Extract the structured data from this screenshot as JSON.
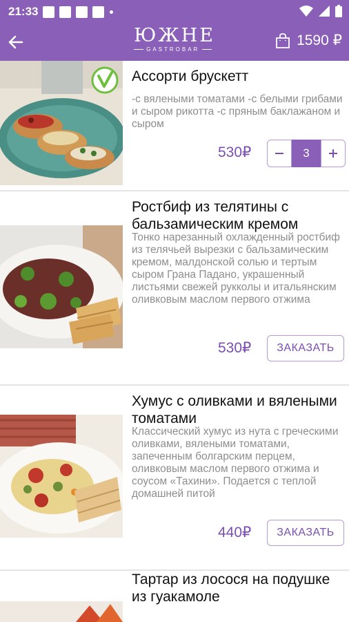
{
  "status": {
    "time": "21:33"
  },
  "appbar": {
    "logo_main": "ЮЖНЕ",
    "logo_sub": "GASTROBAR",
    "cart_amount": "1590 ₽"
  },
  "products": [
    {
      "title": "Ассорти брускетт",
      "description": "-с вялеными томатами -с белыми грибами и сыром рикотта -с пряным баклажаном и сыром",
      "price": "530₽",
      "quantity": "3",
      "vegetarian": true
    },
    {
      "title": "Ростбиф из телятины с бальзамическим кремом",
      "description": "Тонко нарезанный охлажденный ростбиф из телячьей вырезки с бальзамическим кремом, малдонской солью и тертым сыром Грана Падано, украшенный листьями свежей рукколы и итальянским оливковым маслом первого отжима",
      "price": "530₽",
      "button": "ЗАКАЗАТЬ"
    },
    {
      "title": "Хумус с оливками и вялеными томатами",
      "description": "Классический хумус из нута с греческими оливками, вялеными томатами, запеченным болгарским перцем, оливковым маслом первого отжима и соусом «Тахини». Подается с теплой домашней питой",
      "price": "440₽",
      "button": "ЗАКАЗАТЬ"
    },
    {
      "title": "Тартар из лосося на подушке из гуакамоле"
    }
  ],
  "colors": {
    "accent": "#8a5fb7",
    "price": "#7a4fb0",
    "description": "#8d8d8d"
  }
}
